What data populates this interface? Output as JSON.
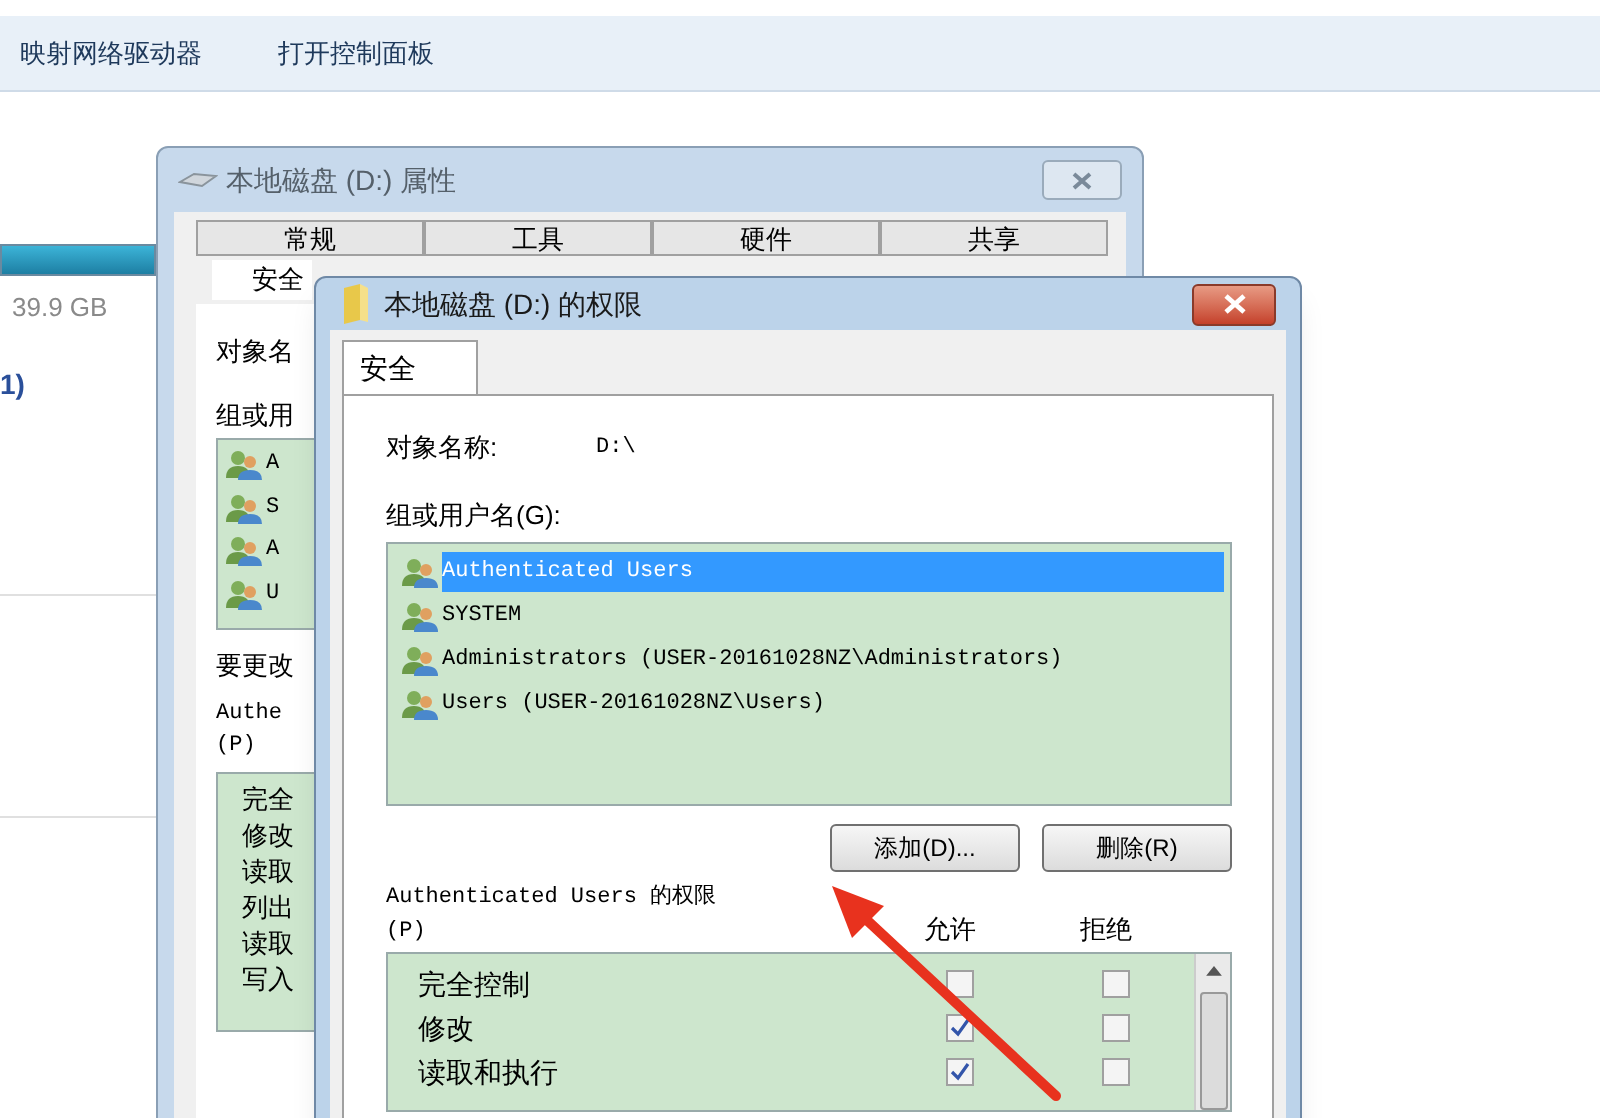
{
  "toolbar": {
    "items": [
      "映射网络驱动器",
      "打开控制面板"
    ]
  },
  "background": {
    "drive_size": "39.9 GB",
    "drive_count": "1)"
  },
  "properties_window": {
    "title": "本地磁盘 (D:) 属性",
    "tabs": [
      {
        "label": "常规",
        "selected": false
      },
      {
        "label": "工具",
        "selected": false
      },
      {
        "label": "硬件",
        "selected": false
      },
      {
        "label": "共享",
        "selected": false
      },
      {
        "label": "安全",
        "selected": true
      }
    ],
    "object_label": "对象名",
    "group_label": "组或用",
    "users": [
      "A",
      "S",
      "A",
      "U"
    ],
    "change_label": "要更改",
    "permissions_label": "Authe",
    "permissions_hotkey": "(P)",
    "permissions": [
      "完全",
      "修改",
      "读取",
      "列出",
      "读取",
      "写入"
    ]
  },
  "permissions_window": {
    "title": "本地磁盘 (D:) 的权限",
    "tabs": [
      {
        "label": "安全",
        "selected": true
      }
    ],
    "object_label": "对象名称:",
    "object_value": "D:\\",
    "group_label": "组或用户名(G):",
    "users": [
      {
        "name": "Authenticated Users",
        "selected": true
      },
      {
        "name": "SYSTEM",
        "selected": false
      },
      {
        "name": "Administrators (USER-20161028NZ\\Administrators)",
        "selected": false
      },
      {
        "name": "Users (USER-20161028NZ\\Users)",
        "selected": false
      }
    ],
    "buttons": [
      "添加(D)...",
      "删除(R)"
    ],
    "permissions_label": "Authenticated Users 的权限",
    "permissions_hotkey": "(P)",
    "columns": [
      "允许",
      "拒绝"
    ],
    "permissions": [
      {
        "name": "完全控制",
        "allow": false,
        "deny": false
      },
      {
        "name": "修改",
        "allow": true,
        "deny": false
      },
      {
        "name": "读取和执行",
        "allow": true,
        "deny": false
      }
    ]
  }
}
